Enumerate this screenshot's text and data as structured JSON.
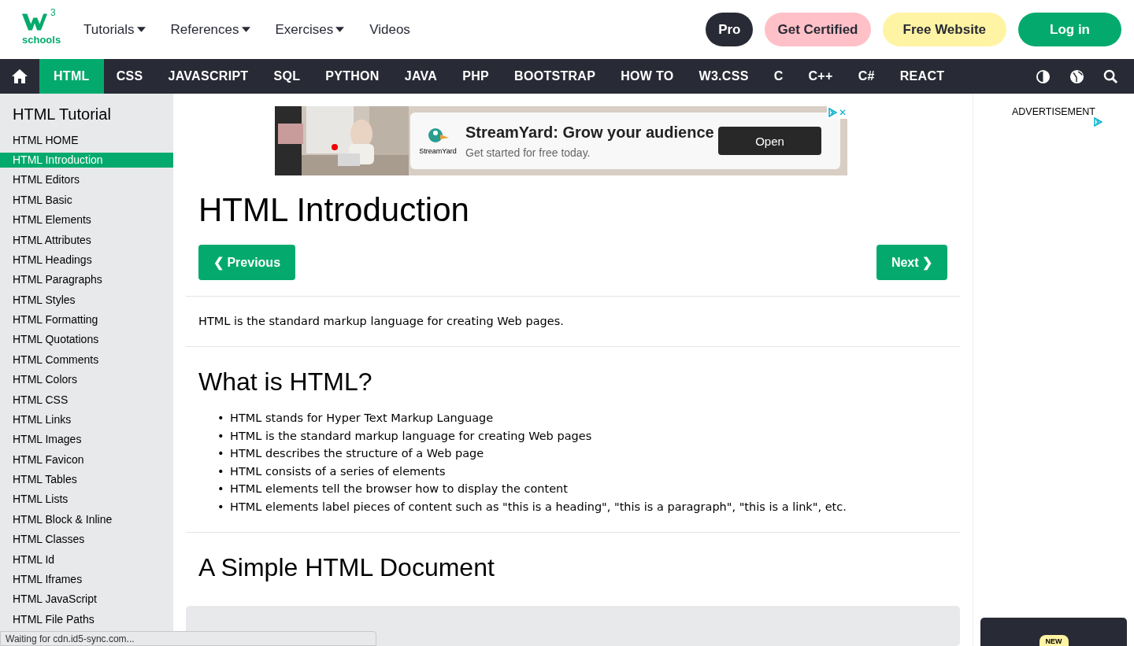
{
  "logo": {
    "mark": "3",
    "word": "schools"
  },
  "top_menu": [
    {
      "label": "Tutorials",
      "dropdown": true
    },
    {
      "label": "References",
      "dropdown": true
    },
    {
      "label": "Exercises",
      "dropdown": true
    },
    {
      "label": "Videos",
      "dropdown": false
    }
  ],
  "top_buttons": [
    {
      "label": "Pro",
      "kind": "pro"
    },
    {
      "label": "Get Certified",
      "kind": "certified"
    },
    {
      "label": "Free Website",
      "kind": "website"
    },
    {
      "label": "Log in",
      "kind": "login"
    }
  ],
  "nav_tabs": [
    {
      "label": "HTML",
      "selected": true
    },
    {
      "label": "CSS",
      "selected": false
    },
    {
      "label": "JAVASCRIPT",
      "selected": false
    },
    {
      "label": "SQL",
      "selected": false
    },
    {
      "label": "PYTHON",
      "selected": false
    },
    {
      "label": "JAVA",
      "selected": false
    },
    {
      "label": "PHP",
      "selected": false
    },
    {
      "label": "BOOTSTRAP",
      "selected": false
    },
    {
      "label": "HOW TO",
      "selected": false
    },
    {
      "label": "W3.CSS",
      "selected": false
    },
    {
      "label": "C",
      "selected": false
    },
    {
      "label": "C++",
      "selected": false
    },
    {
      "label": "C#",
      "selected": false
    },
    {
      "label": "REACT",
      "selected": false
    }
  ],
  "sidebar": {
    "title": "HTML Tutorial",
    "items": [
      {
        "label": "HTML HOME",
        "selected": false
      },
      {
        "label": "HTML Introduction",
        "selected": true
      },
      {
        "label": "HTML Editors",
        "selected": false
      },
      {
        "label": "HTML Basic",
        "selected": false
      },
      {
        "label": "HTML Elements",
        "selected": false
      },
      {
        "label": "HTML Attributes",
        "selected": false
      },
      {
        "label": "HTML Headings",
        "selected": false
      },
      {
        "label": "HTML Paragraphs",
        "selected": false
      },
      {
        "label": "HTML Styles",
        "selected": false
      },
      {
        "label": "HTML Formatting",
        "selected": false
      },
      {
        "label": "HTML Quotations",
        "selected": false
      },
      {
        "label": "HTML Comments",
        "selected": false
      },
      {
        "label": "HTML Colors",
        "selected": false
      },
      {
        "label": "HTML CSS",
        "selected": false
      },
      {
        "label": "HTML Links",
        "selected": false
      },
      {
        "label": "HTML Images",
        "selected": false
      },
      {
        "label": "HTML Favicon",
        "selected": false
      },
      {
        "label": "HTML Tables",
        "selected": false
      },
      {
        "label": "HTML Lists",
        "selected": false
      },
      {
        "label": "HTML Block & Inline",
        "selected": false
      },
      {
        "label": "HTML Classes",
        "selected": false
      },
      {
        "label": "HTML Id",
        "selected": false
      },
      {
        "label": "HTML Iframes",
        "selected": false
      },
      {
        "label": "HTML JavaScript",
        "selected": false
      },
      {
        "label": "HTML File Paths",
        "selected": false
      }
    ]
  },
  "ad": {
    "brand": "StreamYard",
    "headline": "StreamYard: Grow your audience",
    "subline": "Get started for free today.",
    "button": "Open",
    "close": "✕"
  },
  "main": {
    "title": "HTML Introduction",
    "prev": "❮ Previous",
    "next": "Next ❯",
    "intro": "HTML is the standard markup language for creating Web pages.",
    "section1": "What is HTML?",
    "marker": "•",
    "bullets": [
      "HTML stands for Hyper Text Markup Language",
      "HTML is the standard markup language for creating Web pages",
      "HTML describes the structure of a Web page",
      "HTML consists of a series of elements",
      "HTML elements tell the browser how to display the content",
      "HTML elements label pieces of content such as \"this is a heading\", \"this is a paragraph\", \"this is a link\", etc."
    ],
    "section2": "A Simple HTML Document"
  },
  "right": {
    "ad_label": "ADVERTISEMENT",
    "badge": "NEW"
  },
  "status_bar": "Waiting for cdn.id5-sync.com..."
}
